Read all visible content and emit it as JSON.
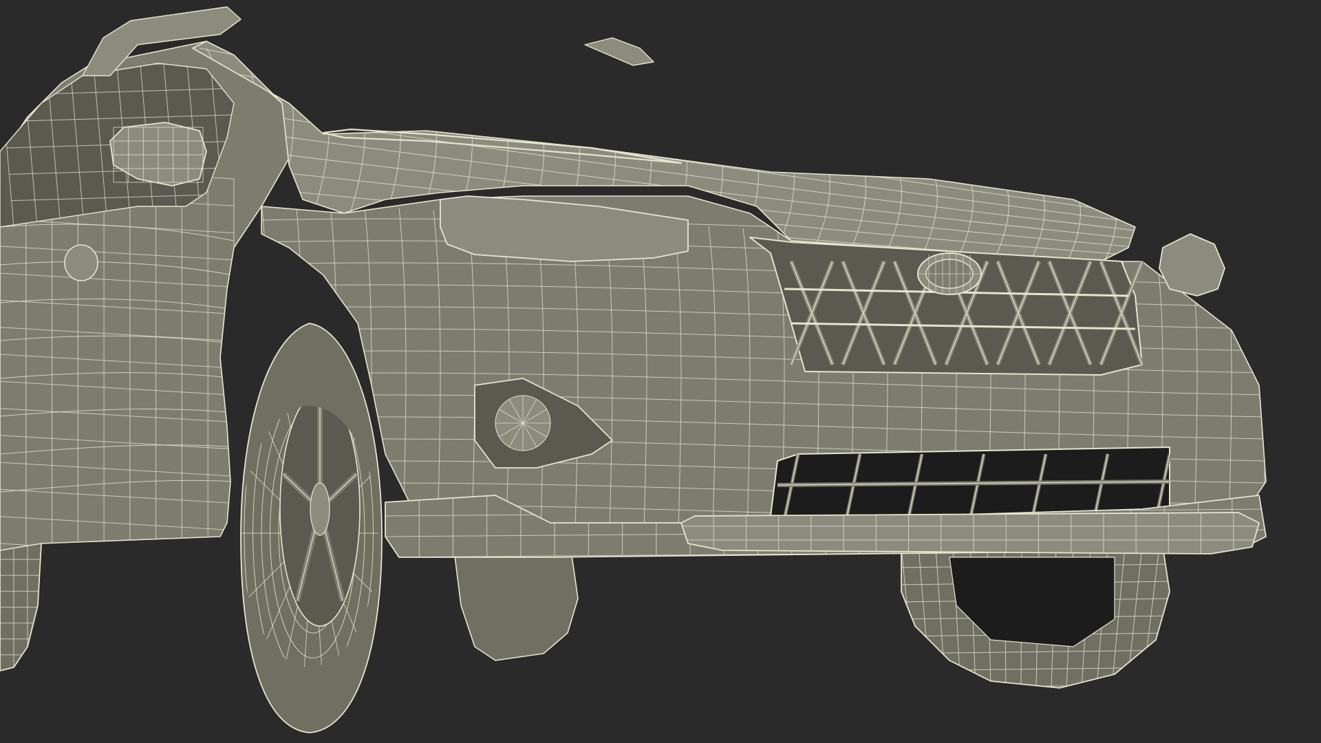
{
  "scene": {
    "background_color": "#2a2a2a",
    "body_color": "#7d7d6f",
    "body_shadow_color": "#5a5a50",
    "body_highlight_color": "#8c8c7e",
    "wire_color": "#e6e6cf",
    "opening_color": "#1c1c1c",
    "tire_color": "#6f6f62",
    "render_style": "wireframe-on-shaded",
    "subject": "car-front-three-quarter"
  }
}
